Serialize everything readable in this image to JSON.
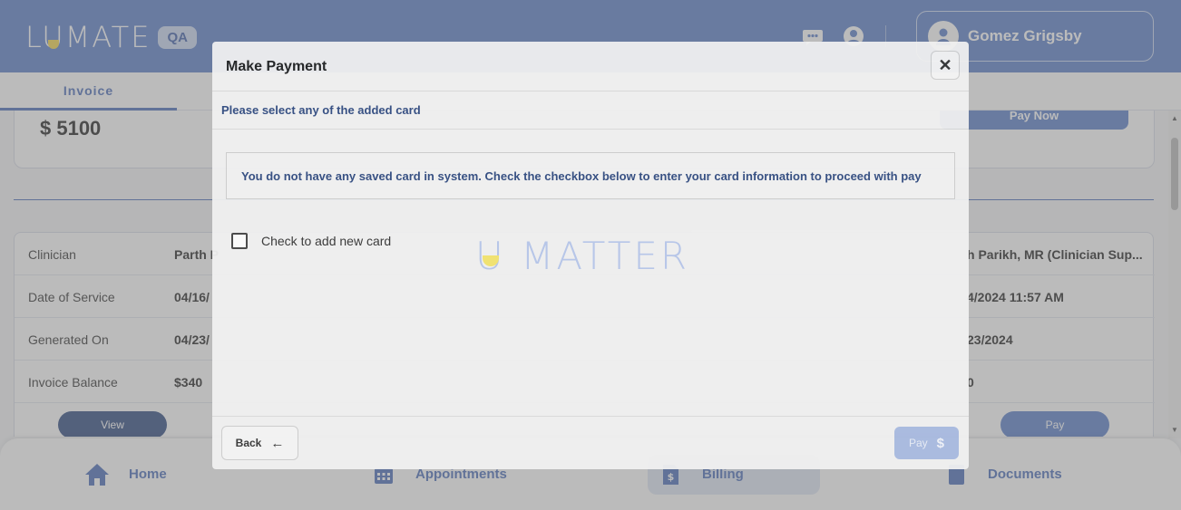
{
  "header": {
    "logo": "LUMATE",
    "env_badge": "QA",
    "user_name": "Gomez Grigsby",
    "icons": [
      "chat-icon",
      "account-icon",
      "user-avatar-icon"
    ]
  },
  "tabs": [
    {
      "label": "Invoice",
      "active": true
    }
  ],
  "invoice": {
    "amount": "$ 5100",
    "pay_now_label": "Pay Now",
    "rows": [
      {
        "label": "Clinician",
        "value": "Parth P",
        "value2": "h Parikh, MR (Clinician Sup..."
      },
      {
        "label": "Date of Service",
        "value": "04/16/",
        "value2": "4/2024 11:57 AM"
      },
      {
        "label": "Generated On",
        "value": "04/23/",
        "value2": "23/2024"
      },
      {
        "label": "Invoice Balance",
        "value": "$340",
        "value2": "0"
      }
    ],
    "view_label": "View",
    "pay_label": "Pay"
  },
  "bottom_nav": [
    {
      "label": "Home",
      "icon": "home-icon"
    },
    {
      "label": "Appointments",
      "icon": "calendar-icon"
    },
    {
      "label": "Billing",
      "icon": "billing-icon",
      "active": true
    },
    {
      "label": "Documents",
      "icon": "document-icon"
    }
  ],
  "modal": {
    "title": "Make Payment",
    "subtitle": "Please select any of the added card",
    "info": "You do not have any saved card in system. Check the checkbox below to enter your card information to proceed with pay",
    "checkbox_label": "Check to add new card",
    "checkbox_checked": false,
    "watermark": "U MATTER",
    "back_label": "Back",
    "pay_label": "Pay",
    "close_symbol": "✕",
    "back_arrow": "←",
    "dollar": "$"
  },
  "colors": {
    "brand": "#5a7ec9",
    "dark_brand": "#2f4a80",
    "accent_yellow": "#f2d54a"
  }
}
